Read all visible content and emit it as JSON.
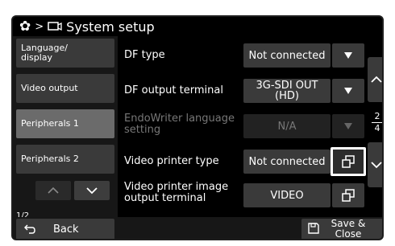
{
  "titlebar": {
    "separator": ">",
    "title": "System setup"
  },
  "sidebar": {
    "items": [
      {
        "label": "Language/ display"
      },
      {
        "label": "Video output"
      },
      {
        "label": "Peripherals 1"
      },
      {
        "label": "Peripherals 2"
      }
    ],
    "page": "1/2"
  },
  "rows": [
    {
      "label": "DF type",
      "value": "Not connected"
    },
    {
      "label": "DF output terminal",
      "value": "3G-SDI OUT (HD)"
    },
    {
      "label": "EndoWriter language setting",
      "value": "N/A"
    },
    {
      "label": "Video printer type",
      "value": "Not connected"
    },
    {
      "label": "Video printer image output terminal",
      "value": "VIDEO"
    }
  ],
  "scroll": {
    "current": "2",
    "total": "4"
  },
  "bottom": {
    "back_label": "Back",
    "save_label": "Save & Close"
  },
  "icons": [
    "gear-icon",
    "monitor-icon",
    "dropdown-arrow-icon",
    "window-icon",
    "chevron-up-icon",
    "chevron-down-icon",
    "back-arrow-icon",
    "floppy-icon"
  ],
  "colors": {
    "active_item": "#6b6b6b",
    "button": "#3a3a3a",
    "disabled_text": "#777777"
  }
}
